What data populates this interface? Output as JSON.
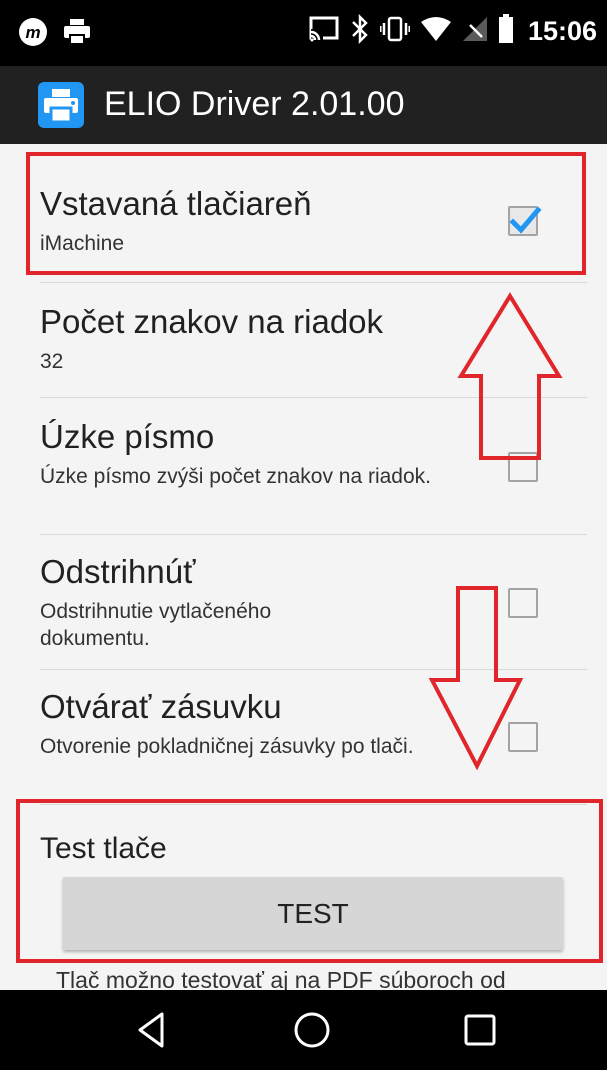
{
  "status_bar": {
    "time": "15:06",
    "left_icons": [
      "app-notification-icon",
      "printer-notification-icon"
    ],
    "right_icons": [
      "cast-icon",
      "bluetooth-icon",
      "vibrate-icon",
      "wifi-icon",
      "no-signal-icon",
      "battery-icon"
    ]
  },
  "app": {
    "title": "ELIO Driver 2.01.00",
    "icon": "printer-icon",
    "accent_color": "#2196f3"
  },
  "preferences": [
    {
      "title": "Vstavaná tlačiareň",
      "summary": "iMachine",
      "checked": true
    },
    {
      "title": "Počet znakov na riadok",
      "summary": "32"
    },
    {
      "title": "Úzke písmo",
      "summary": "Úzke písmo zvýši počet znakov na riadok.",
      "checked": false
    },
    {
      "title": "Odstrihnúť",
      "summary": "Odstrihnutie vytlačeného dokumentu.",
      "checked": false
    },
    {
      "title": "Otvárať zásuvku",
      "summary": "Otvorenie pokladničnej zásuvky po tlači.",
      "checked": false
    }
  ],
  "test_section": {
    "title": "Test tlače",
    "button_label": "TEST",
    "note": "Tlač možno testovať aj na PDF súboroch od"
  },
  "annotations": {
    "color": "#e0262b",
    "up_arrow": "arrow-up-icon",
    "down_arrow": "arrow-down-icon"
  },
  "nav_bar": {
    "buttons": [
      "back-icon",
      "home-icon",
      "recents-icon"
    ]
  }
}
